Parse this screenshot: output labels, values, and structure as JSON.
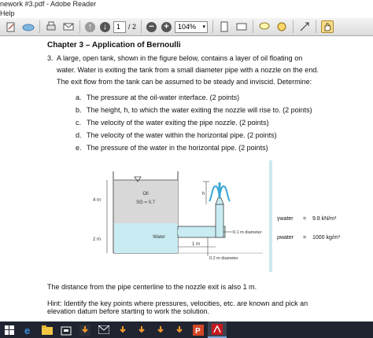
{
  "window": {
    "title": "nework #3.pdf - Adobe Reader"
  },
  "menu": {
    "help_label": "Help"
  },
  "toolbar": {
    "page_current": "1",
    "page_total": "/ 2",
    "zoom": "104%"
  },
  "document": {
    "chapter_title": "Chapter 3 – Application of Bernoulli",
    "problem_number": "3.",
    "problem_line1": "A large, open tank, shown in the figure below, contains a layer of oil floating on",
    "problem_line2": "water.  Water is exiting the tank from a small diameter pipe with a nozzle on the end.",
    "problem_line3": "The exit flow from the tank can be assumed to be steady and inviscid.  Determine:",
    "items": [
      {
        "letter": "a.",
        "text": "The pressure at the oil-water interface. (2 points)"
      },
      {
        "letter": "b.",
        "text": "The height, h, to which the water exiting the nozzle will rise to.  (2 points)"
      },
      {
        "letter": "c.",
        "text": "The velocity of the water exiting the pipe nozzle. (2 points)"
      },
      {
        "letter": "d.",
        "text": "The velocity of the water within the horizontal pipe. (2 points)"
      },
      {
        "letter": "e.",
        "text": "The pressure of the water in the horizontal pipe. (2 points)"
      }
    ],
    "figure": {
      "oil_label": "Oil",
      "sg_label": "SG = 0.7",
      "water_label": "Water",
      "dim_4m": "4 m",
      "dim_2m": "2 m",
      "dim_1m": "1 m",
      "dim_h": "h",
      "pipe_d1": "0.1 m diameter",
      "pipe_d2": "0.2 m diameter",
      "gamma_label": "γwater",
      "gamma_eq": "=",
      "gamma_value": "9.8 kN/m³",
      "rho_label": "ρwater",
      "rho_eq": "=",
      "rho_value": "1000 kg/m³"
    },
    "distance_note": "The distance from the pipe centerline to the nozzle exit is also 1 m.",
    "hint_line1": "Hint:  Identify the key points where pressures, velocities, etc. are known and pick an",
    "hint_line2": "elevation datum before starting to work the solution."
  },
  "colors": {
    "oil_fill": "#d8d8d8",
    "water_fill": "#c8ecf2",
    "jet_color": "#3aa7d6",
    "taskbar_bg": "#1f2430"
  },
  "taskbar": {
    "icons": [
      "windows-logo-icon",
      "edge-browser-icon",
      "file-explorer-icon",
      "store-icon",
      "download-app-icon",
      "mail-icon",
      "download-app-icon-2",
      "download-app-icon-3",
      "download-app-icon-4",
      "download-app-icon-5",
      "powerpoint-icon",
      "adobe-reader-icon"
    ]
  }
}
